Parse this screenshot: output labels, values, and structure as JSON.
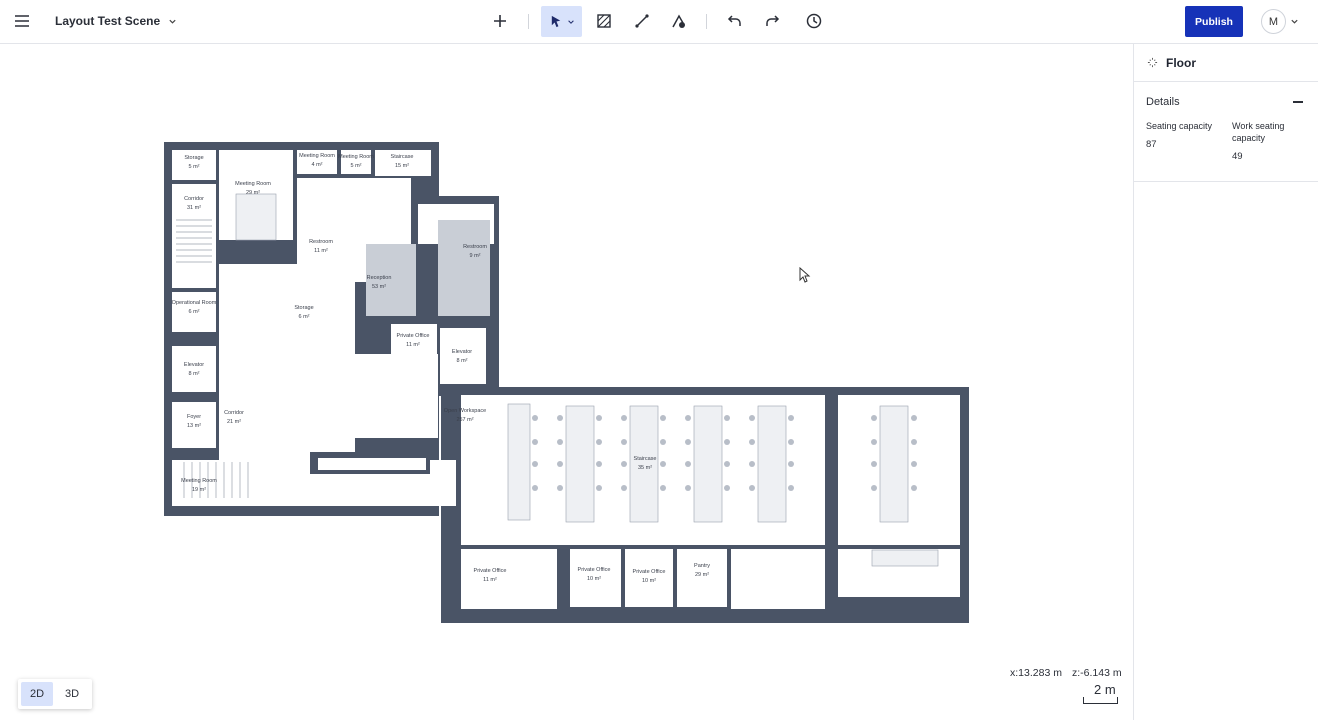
{
  "header": {
    "scene_title": "Layout Test Scene",
    "publish_label": "Publish",
    "avatar_initial": "M",
    "icons": [
      "menu-icon",
      "chevron-down-icon",
      "plus-icon",
      "select-cursor-icon",
      "hatch-area-icon",
      "line-draw-icon",
      "shape-icon",
      "undo-icon",
      "redo-icon",
      "history-icon"
    ]
  },
  "canvas": {
    "coord_x": "x:13.283 m",
    "coord_z": "z:-6.143 m",
    "scale_label": "2 m",
    "view_modes": [
      "2D",
      "3D"
    ],
    "active_view": "2D",
    "rooms": [
      {
        "name": "Storage",
        "area": "5 m²"
      },
      {
        "name": "Meeting Room",
        "area": "29 m²"
      },
      {
        "name": "Meeting Room",
        "area": "4 m²"
      },
      {
        "name": "Meeting Room",
        "area": "5 m²"
      },
      {
        "name": "Staircase",
        "area": "15 m²"
      },
      {
        "name": "Corridor",
        "area": "31 m²"
      },
      {
        "name": "Restroom",
        "area": "11 m²"
      },
      {
        "name": "Restroom",
        "area": "9 m²"
      },
      {
        "name": "Reception",
        "area": "53 m²"
      },
      {
        "name": "Storage",
        "area": "6 m²"
      },
      {
        "name": "Operational Room",
        "area": "6 m²"
      },
      {
        "name": "Private Office",
        "area": "11 m²"
      },
      {
        "name": "Elevator",
        "area": "8 m²"
      },
      {
        "name": "Elevator",
        "area": "8 m²"
      },
      {
        "name": "Foyer",
        "area": "13 m²"
      },
      {
        "name": "Corridor",
        "area": "21 m²"
      },
      {
        "name": "Open Workspace",
        "area": "257 m²"
      },
      {
        "name": "Staircase",
        "area": "35 m²"
      },
      {
        "name": "Meeting Room",
        "area": "19 m²"
      },
      {
        "name": "Private Office",
        "area": "11 m²"
      },
      {
        "name": "Private Office",
        "area": "10 m²"
      },
      {
        "name": "Private Office",
        "area": "10 m²"
      },
      {
        "name": "Pantry",
        "area": "29 m²"
      }
    ]
  },
  "panel": {
    "title": "Floor",
    "section_title": "Details",
    "seating_label": "Seating capacity",
    "seating_value": "87",
    "work_label": "Work seating capacity",
    "work_value": "49"
  },
  "colors": {
    "accent": "#1632b8",
    "active_tool_bg": "#d8e2fb",
    "wall": "#4a5466",
    "restroom": "#c9ced6"
  }
}
